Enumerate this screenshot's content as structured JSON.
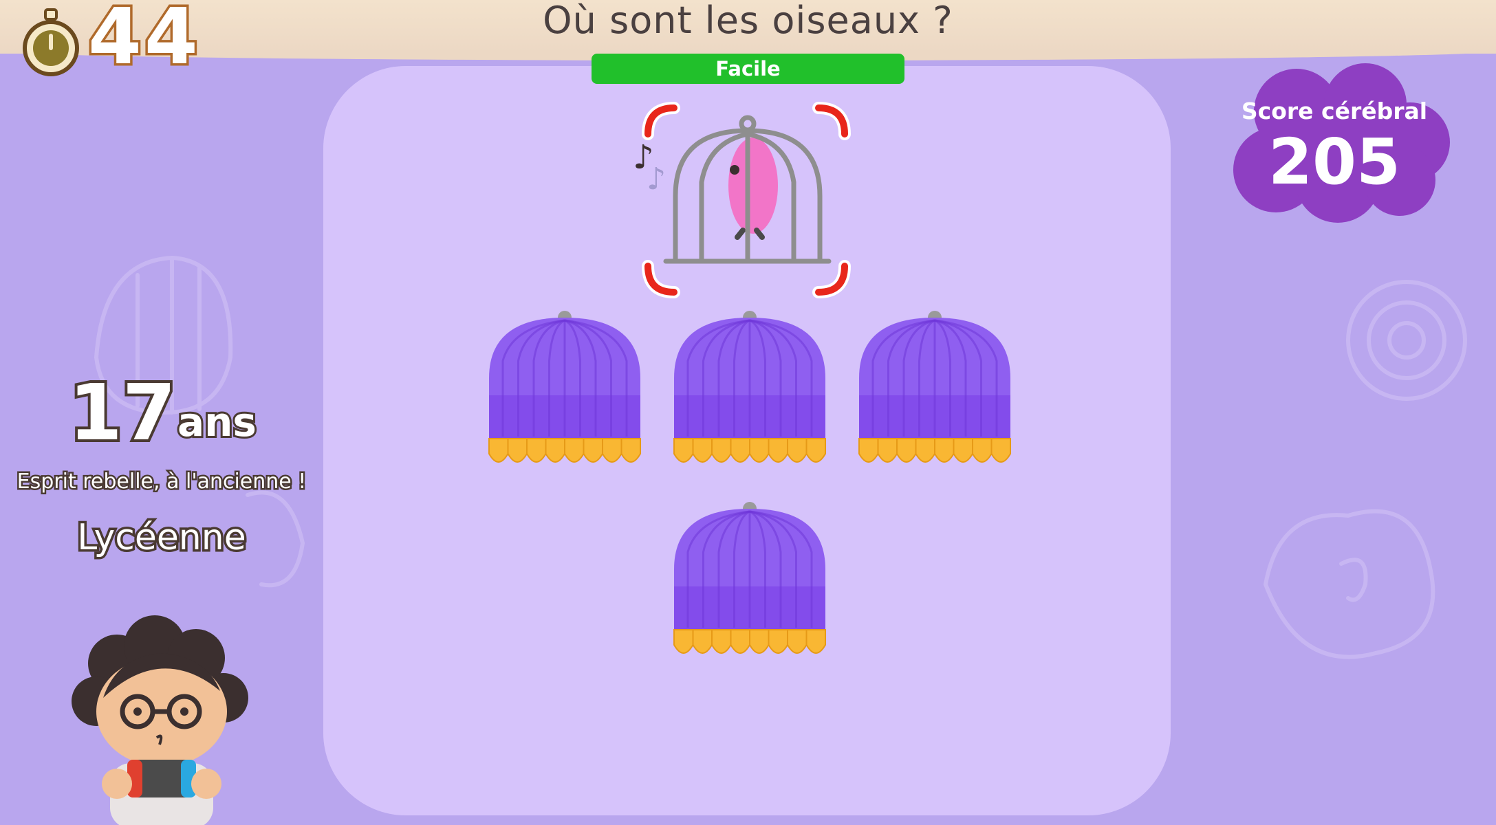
{
  "header": {
    "question": "Où sont les oiseaux ?",
    "timer": "44"
  },
  "difficulty": {
    "label": "Facile",
    "color": "#21c02b"
  },
  "score": {
    "label": "Score cérébral",
    "value": "205"
  },
  "brain_age": {
    "value": "17",
    "unit": "ans",
    "comment": "Esprit rebelle, à l'ancienne !",
    "title": "Lycéenne"
  },
  "cages": {
    "revealed": {
      "contents": "pink-bird-icon"
    },
    "covered": [
      {
        "id": "cage-1"
      },
      {
        "id": "cage-2"
      },
      {
        "id": "cage-3"
      },
      {
        "id": "cage-4"
      }
    ]
  },
  "colors": {
    "background": "#b9a6ee",
    "panel": "#d6c3fb",
    "cover": "#8f5ff0",
    "cover_trim": "#f9b733",
    "selection": "#e8261b"
  }
}
